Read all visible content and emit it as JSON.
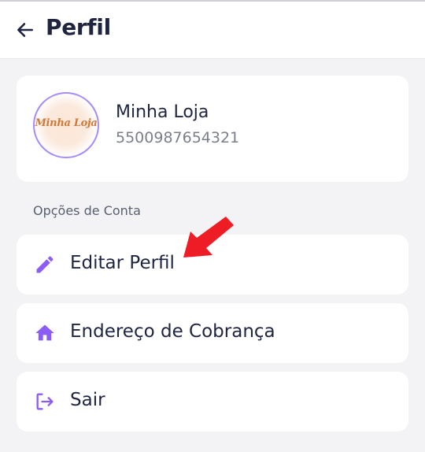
{
  "header": {
    "title": "Perfil",
    "back_icon": "arrow-left-icon"
  },
  "profile": {
    "name": "Minha Loja",
    "phone": "5500987654321",
    "avatar_text": "Minha Loja"
  },
  "section_label": "Opções de Conta",
  "options": [
    {
      "label": "Editar Perfil",
      "icon": "pencil-icon"
    },
    {
      "label": "Endereço de Cobrança",
      "icon": "home-icon"
    },
    {
      "label": "Sair",
      "icon": "logout-icon"
    }
  ],
  "colors": {
    "accent": "#8b5cf6",
    "annotation_arrow": "#ee1c25",
    "background": "#f3f3f6",
    "card": "#ffffff",
    "text": "#1f2540"
  }
}
